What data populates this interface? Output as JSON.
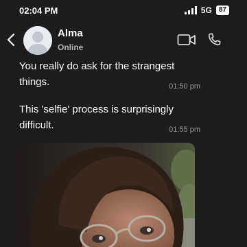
{
  "status_bar": {
    "time": "02:04 PM",
    "network": "5G",
    "battery": "87"
  },
  "header": {
    "contact_name": "Alma",
    "contact_status": "Online",
    "icons": {
      "back": "chevron-left-icon",
      "avatar": "person-silhouette-icon",
      "video": "video-camera-icon",
      "call": "phone-icon"
    }
  },
  "messages": [
    {
      "text": "You really do ask for the strangest things.",
      "time": "01:50 pm"
    },
    {
      "text": "This 'selfie' process is surprisingly difficult.",
      "time": "01:55 pm"
    }
  ],
  "photo": {
    "kind": "selfie-photo"
  },
  "colors": {
    "background": "#1c1c1c",
    "text": "#ffffff",
    "timestamp": "#9a9a9a",
    "status_subtext": "#b5b5b5"
  }
}
